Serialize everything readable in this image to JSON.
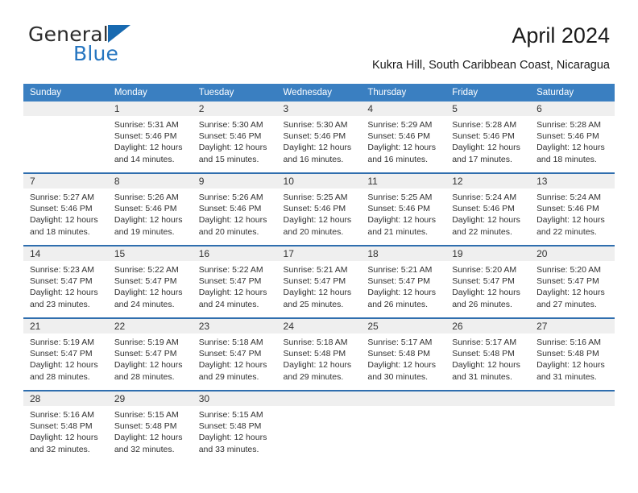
{
  "brand": {
    "name_part1": "General",
    "name_part2": "Blue",
    "logo_icon": "triangle-icon",
    "accent_color": "#2575c0",
    "triangle_color": "#1769b0"
  },
  "header": {
    "title": "April 2024",
    "subtitle": "Kukra Hill, South Caribbean Coast, Nicaragua"
  },
  "calendar": {
    "header_bg": "#3a7fc1",
    "row_divider_color": "#2f6eae",
    "daynum_bg": "#efefef",
    "weekdays": [
      "Sunday",
      "Monday",
      "Tuesday",
      "Wednesday",
      "Thursday",
      "Friday",
      "Saturday"
    ],
    "weeks": [
      [
        {
          "day": "",
          "sunrise": "",
          "sunset": "",
          "daylight1": "",
          "daylight2": ""
        },
        {
          "day": "1",
          "sunrise": "Sunrise: 5:31 AM",
          "sunset": "Sunset: 5:46 PM",
          "daylight1": "Daylight: 12 hours",
          "daylight2": "and 14 minutes."
        },
        {
          "day": "2",
          "sunrise": "Sunrise: 5:30 AM",
          "sunset": "Sunset: 5:46 PM",
          "daylight1": "Daylight: 12 hours",
          "daylight2": "and 15 minutes."
        },
        {
          "day": "3",
          "sunrise": "Sunrise: 5:30 AM",
          "sunset": "Sunset: 5:46 PM",
          "daylight1": "Daylight: 12 hours",
          "daylight2": "and 16 minutes."
        },
        {
          "day": "4",
          "sunrise": "Sunrise: 5:29 AM",
          "sunset": "Sunset: 5:46 PM",
          "daylight1": "Daylight: 12 hours",
          "daylight2": "and 16 minutes."
        },
        {
          "day": "5",
          "sunrise": "Sunrise: 5:28 AM",
          "sunset": "Sunset: 5:46 PM",
          "daylight1": "Daylight: 12 hours",
          "daylight2": "and 17 minutes."
        },
        {
          "day": "6",
          "sunrise": "Sunrise: 5:28 AM",
          "sunset": "Sunset: 5:46 PM",
          "daylight1": "Daylight: 12 hours",
          "daylight2": "and 18 minutes."
        }
      ],
      [
        {
          "day": "7",
          "sunrise": "Sunrise: 5:27 AM",
          "sunset": "Sunset: 5:46 PM",
          "daylight1": "Daylight: 12 hours",
          "daylight2": "and 18 minutes."
        },
        {
          "day": "8",
          "sunrise": "Sunrise: 5:26 AM",
          "sunset": "Sunset: 5:46 PM",
          "daylight1": "Daylight: 12 hours",
          "daylight2": "and 19 minutes."
        },
        {
          "day": "9",
          "sunrise": "Sunrise: 5:26 AM",
          "sunset": "Sunset: 5:46 PM",
          "daylight1": "Daylight: 12 hours",
          "daylight2": "and 20 minutes."
        },
        {
          "day": "10",
          "sunrise": "Sunrise: 5:25 AM",
          "sunset": "Sunset: 5:46 PM",
          "daylight1": "Daylight: 12 hours",
          "daylight2": "and 20 minutes."
        },
        {
          "day": "11",
          "sunrise": "Sunrise: 5:25 AM",
          "sunset": "Sunset: 5:46 PM",
          "daylight1": "Daylight: 12 hours",
          "daylight2": "and 21 minutes."
        },
        {
          "day": "12",
          "sunrise": "Sunrise: 5:24 AM",
          "sunset": "Sunset: 5:46 PM",
          "daylight1": "Daylight: 12 hours",
          "daylight2": "and 22 minutes."
        },
        {
          "day": "13",
          "sunrise": "Sunrise: 5:24 AM",
          "sunset": "Sunset: 5:46 PM",
          "daylight1": "Daylight: 12 hours",
          "daylight2": "and 22 minutes."
        }
      ],
      [
        {
          "day": "14",
          "sunrise": "Sunrise: 5:23 AM",
          "sunset": "Sunset: 5:47 PM",
          "daylight1": "Daylight: 12 hours",
          "daylight2": "and 23 minutes."
        },
        {
          "day": "15",
          "sunrise": "Sunrise: 5:22 AM",
          "sunset": "Sunset: 5:47 PM",
          "daylight1": "Daylight: 12 hours",
          "daylight2": "and 24 minutes."
        },
        {
          "day": "16",
          "sunrise": "Sunrise: 5:22 AM",
          "sunset": "Sunset: 5:47 PM",
          "daylight1": "Daylight: 12 hours",
          "daylight2": "and 24 minutes."
        },
        {
          "day": "17",
          "sunrise": "Sunrise: 5:21 AM",
          "sunset": "Sunset: 5:47 PM",
          "daylight1": "Daylight: 12 hours",
          "daylight2": "and 25 minutes."
        },
        {
          "day": "18",
          "sunrise": "Sunrise: 5:21 AM",
          "sunset": "Sunset: 5:47 PM",
          "daylight1": "Daylight: 12 hours",
          "daylight2": "and 26 minutes."
        },
        {
          "day": "19",
          "sunrise": "Sunrise: 5:20 AM",
          "sunset": "Sunset: 5:47 PM",
          "daylight1": "Daylight: 12 hours",
          "daylight2": "and 26 minutes."
        },
        {
          "day": "20",
          "sunrise": "Sunrise: 5:20 AM",
          "sunset": "Sunset: 5:47 PM",
          "daylight1": "Daylight: 12 hours",
          "daylight2": "and 27 minutes."
        }
      ],
      [
        {
          "day": "21",
          "sunrise": "Sunrise: 5:19 AM",
          "sunset": "Sunset: 5:47 PM",
          "daylight1": "Daylight: 12 hours",
          "daylight2": "and 28 minutes."
        },
        {
          "day": "22",
          "sunrise": "Sunrise: 5:19 AM",
          "sunset": "Sunset: 5:47 PM",
          "daylight1": "Daylight: 12 hours",
          "daylight2": "and 28 minutes."
        },
        {
          "day": "23",
          "sunrise": "Sunrise: 5:18 AM",
          "sunset": "Sunset: 5:47 PM",
          "daylight1": "Daylight: 12 hours",
          "daylight2": "and 29 minutes."
        },
        {
          "day": "24",
          "sunrise": "Sunrise: 5:18 AM",
          "sunset": "Sunset: 5:48 PM",
          "daylight1": "Daylight: 12 hours",
          "daylight2": "and 29 minutes."
        },
        {
          "day": "25",
          "sunrise": "Sunrise: 5:17 AM",
          "sunset": "Sunset: 5:48 PM",
          "daylight1": "Daylight: 12 hours",
          "daylight2": "and 30 minutes."
        },
        {
          "day": "26",
          "sunrise": "Sunrise: 5:17 AM",
          "sunset": "Sunset: 5:48 PM",
          "daylight1": "Daylight: 12 hours",
          "daylight2": "and 31 minutes."
        },
        {
          "day": "27",
          "sunrise": "Sunrise: 5:16 AM",
          "sunset": "Sunset: 5:48 PM",
          "daylight1": "Daylight: 12 hours",
          "daylight2": "and 31 minutes."
        }
      ],
      [
        {
          "day": "28",
          "sunrise": "Sunrise: 5:16 AM",
          "sunset": "Sunset: 5:48 PM",
          "daylight1": "Daylight: 12 hours",
          "daylight2": "and 32 minutes."
        },
        {
          "day": "29",
          "sunrise": "Sunrise: 5:15 AM",
          "sunset": "Sunset: 5:48 PM",
          "daylight1": "Daylight: 12 hours",
          "daylight2": "and 32 minutes."
        },
        {
          "day": "30",
          "sunrise": "Sunrise: 5:15 AM",
          "sunset": "Sunset: 5:48 PM",
          "daylight1": "Daylight: 12 hours",
          "daylight2": "and 33 minutes."
        },
        {
          "day": "",
          "sunrise": "",
          "sunset": "",
          "daylight1": "",
          "daylight2": ""
        },
        {
          "day": "",
          "sunrise": "",
          "sunset": "",
          "daylight1": "",
          "daylight2": ""
        },
        {
          "day": "",
          "sunrise": "",
          "sunset": "",
          "daylight1": "",
          "daylight2": ""
        },
        {
          "day": "",
          "sunrise": "",
          "sunset": "",
          "daylight1": "",
          "daylight2": ""
        }
      ]
    ]
  }
}
